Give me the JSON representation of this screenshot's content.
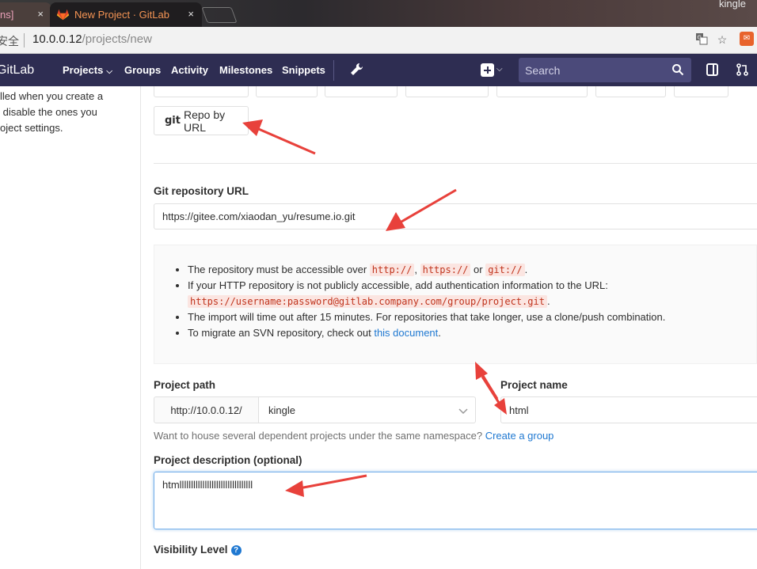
{
  "browser": {
    "tabs": [
      {
        "title": "ns]",
        "active": false
      },
      {
        "title": "New Project · GitLab",
        "active": true
      }
    ],
    "close_glyph": "×",
    "profile_name": "kingle",
    "address": {
      "security_text": "安全",
      "host": "10.0.0.12",
      "path": "/projects/new"
    }
  },
  "navbar": {
    "brand": "GitLab",
    "items": [
      "Projects",
      "Groups",
      "Activity",
      "Milestones",
      "Snippets"
    ],
    "search_placeholder": "Search"
  },
  "sidebar": {
    "text": "lled when you create a\n disable the ones you\noject settings."
  },
  "import": {
    "repo_by_url_prefix": "git",
    "repo_by_url_label": "Repo by URL"
  },
  "form": {
    "git_url_label": "Git repository URL",
    "git_url_value": "https://gitee.com/xiaodan_yu/resume.io.git",
    "info": {
      "line1_pre": "The repository must be accessible over",
      "code_http": "http://",
      "code_https": "https://",
      "or_text": "or",
      "code_git": "git://",
      "line2": "If your HTTP repository is not publicly accessible, add authentication information to the URL:",
      "code_auth_url": "https://username:password@gitlab.company.com/group/project.git",
      "line3": "The import will time out after 15 minutes. For repositories that take longer, use a clone/push combination.",
      "line4_pre": "To migrate an SVN repository, check out",
      "line4_link": "this document"
    },
    "project_path_label": "Project path",
    "project_path_prefix": "http://10.0.0.12/",
    "namespace": "kingle",
    "project_name_label": "Project name",
    "project_name_value": "html",
    "help_text": "Want to house several dependent projects under the same namespace?",
    "help_link": "Create a group",
    "description_label": "Project description (optional)",
    "description_value": "htmllllllllllllllllllllllllllllllll",
    "visibility_label": "Visibility Level",
    "visibility_help": "?"
  },
  "colors": {
    "navbar": "#2e2d52",
    "link": "#1f78d1",
    "annotation_arrow": "#e8413b",
    "active_tab_text": "#f49454"
  }
}
